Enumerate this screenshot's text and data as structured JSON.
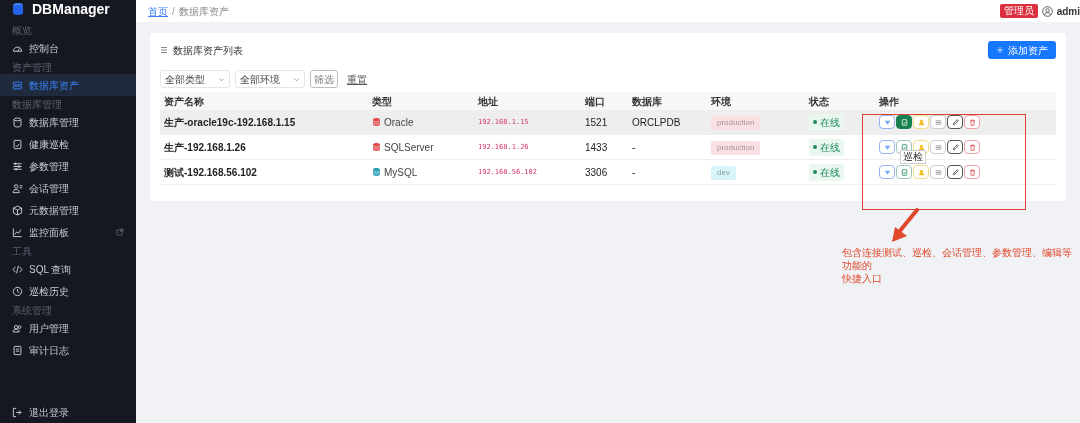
{
  "app": {
    "title": "DBManager"
  },
  "sidebar": {
    "sections": [
      {
        "label": "概览",
        "items": [
          {
            "label": "控制台",
            "selected": false,
            "external": false
          }
        ]
      },
      {
        "label": "资产管理",
        "items": [
          {
            "label": "数据库资产",
            "selected": true,
            "external": false
          }
        ]
      },
      {
        "label": "数据库管理",
        "items": [
          {
            "label": "数据库管理",
            "selected": false,
            "external": false
          },
          {
            "label": "健康巡检",
            "selected": false,
            "external": false
          },
          {
            "label": "参数管理",
            "selected": false,
            "external": false
          },
          {
            "label": "会话管理",
            "selected": false,
            "external": false
          },
          {
            "label": "元数据管理",
            "selected": false,
            "external": false
          },
          {
            "label": "监控面板",
            "selected": false,
            "external": true
          }
        ]
      },
      {
        "label": "工具",
        "items": [
          {
            "label": "SQL 查询",
            "selected": false,
            "external": false
          },
          {
            "label": "巡检历史",
            "selected": false,
            "external": false
          }
        ]
      },
      {
        "label": "系统管理",
        "items": [
          {
            "label": "用户管理",
            "selected": false,
            "external": false
          },
          {
            "label": "审计日志",
            "selected": false,
            "external": false
          }
        ]
      }
    ],
    "logout": "退出登录"
  },
  "header": {
    "breadcrumb": [
      "首页",
      "数据库资产"
    ],
    "breadcrumb_separator": "/",
    "role_badge": "管理员",
    "user": "admi"
  },
  "card": {
    "title": "数据库资产列表",
    "add_button": "添加资产",
    "filters": [
      {
        "value": "全部类型"
      },
      {
        "value": "全部环境"
      }
    ],
    "filter_button": "筛选",
    "reset_link": "重置"
  },
  "table": {
    "columns": [
      "资产名称",
      "类型",
      "地址",
      "端口",
      "数据库",
      "环境",
      "状态",
      "操作"
    ],
    "rows": [
      {
        "name": "生产-oracle19c-192.168.1.15",
        "type": {
          "text": "Oracle",
          "color": "#e5484d"
        },
        "address": "192.168.1.15",
        "port": "1521",
        "database": "ORCLPDB",
        "env": {
          "text": "production",
          "color": "#fbe0e3"
        },
        "status": "在线",
        "hovered": true,
        "actions": [
          {
            "kind": "connect",
            "active": false
          },
          {
            "kind": "inspect",
            "active": true
          },
          {
            "kind": "session",
            "active": false
          },
          {
            "kind": "params",
            "active": false
          },
          {
            "kind": "edit",
            "active": false
          },
          {
            "kind": "delete",
            "active": false
          }
        ]
      },
      {
        "name": "生产-192.168.1.26",
        "type": {
          "text": "SQLServer",
          "color": "#e5484d"
        },
        "address": "192.168.1.26",
        "port": "1433",
        "database": "-",
        "env": {
          "text": "production",
          "color": "#fbe0e3"
        },
        "status": "在线",
        "hovered": false,
        "actions": [
          {
            "kind": "connect",
            "active": false
          },
          {
            "kind": "inspect",
            "active": false
          },
          {
            "kind": "session",
            "active": false
          },
          {
            "kind": "params",
            "active": false
          },
          {
            "kind": "edit",
            "active": false
          },
          {
            "kind": "delete",
            "active": false
          }
        ]
      },
      {
        "name": "测试-192.168.56.102",
        "type": {
          "text": "MySQL",
          "color": "#2a9db5"
        },
        "address": "192.168.56.102",
        "port": "3306",
        "database": "-",
        "env": {
          "text": "dev",
          "color": "#d6f4f9"
        },
        "status": "在线",
        "hovered": false,
        "actions": [
          {
            "kind": "connect",
            "active": false
          },
          {
            "kind": "inspect",
            "active": false
          },
          {
            "kind": "session",
            "active": false
          },
          {
            "kind": "params",
            "active": false
          },
          {
            "kind": "edit",
            "active": false
          },
          {
            "kind": "delete",
            "active": false
          }
        ]
      }
    ]
  },
  "tooltip": "巡检",
  "annotation": {
    "lines": [
      "包含连接测试、巡检、会话管理、参数管理、编辑等功能的",
      "快捷入口"
    ]
  }
}
